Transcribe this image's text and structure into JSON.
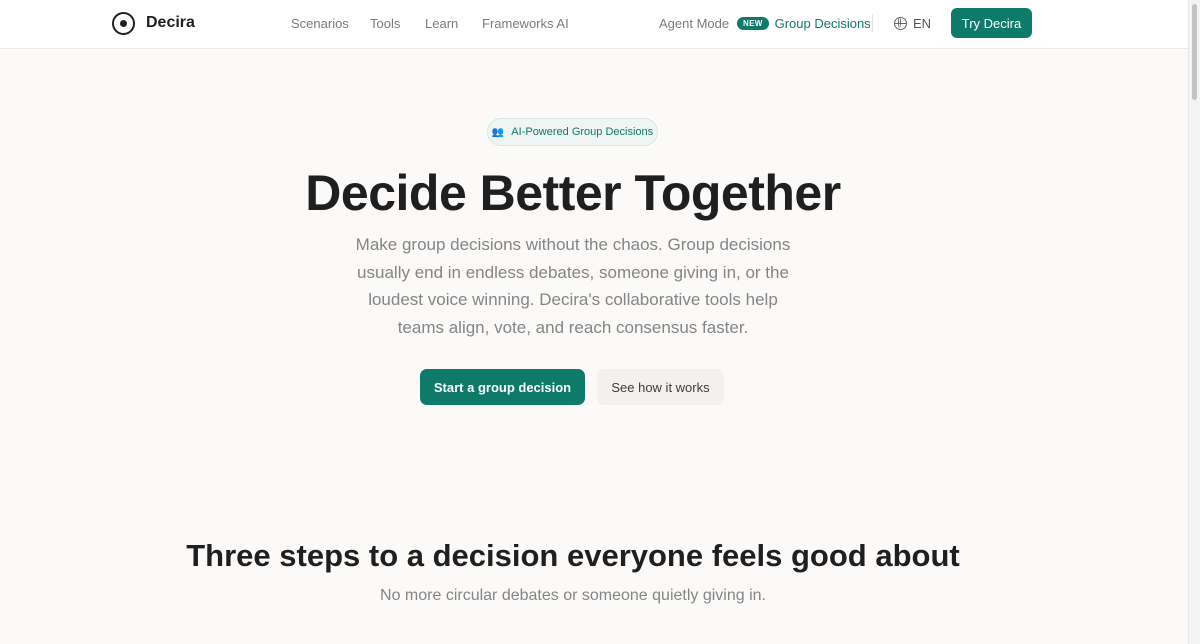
{
  "header": {
    "logo_text": "Decira",
    "nav": {
      "scenarios": "Scenarios",
      "tools": "Tools",
      "learn": "Learn",
      "frameworks": "Frameworks AI",
      "agent_mode": "Agent Mode",
      "new_badge": "NEW",
      "group_decisions": "Group Decisions"
    },
    "language": "EN",
    "cta": "Try Decira"
  },
  "hero": {
    "badge_icon": "people-icon",
    "badge_label": "AI-Powered Group Decisions",
    "title": "Decide Better Together",
    "subtitle": "Make group decisions without the chaos. Group decisions usually end in endless debates, someone giving in, or the loudest voice winning. Decira's collaborative tools help teams align, vote, and reach consensus faster.",
    "primary_button": "Start a group decision",
    "secondary_button": "See how it works"
  },
  "steps": {
    "title": "Three steps to a decision everyone feels good about",
    "subtitle": "No more circular debates or someone quietly giving in."
  },
  "colors": {
    "accent": "#0e7b6a",
    "background": "#fbfaf9",
    "text": "#1f1f1f",
    "muted": "#858585"
  }
}
